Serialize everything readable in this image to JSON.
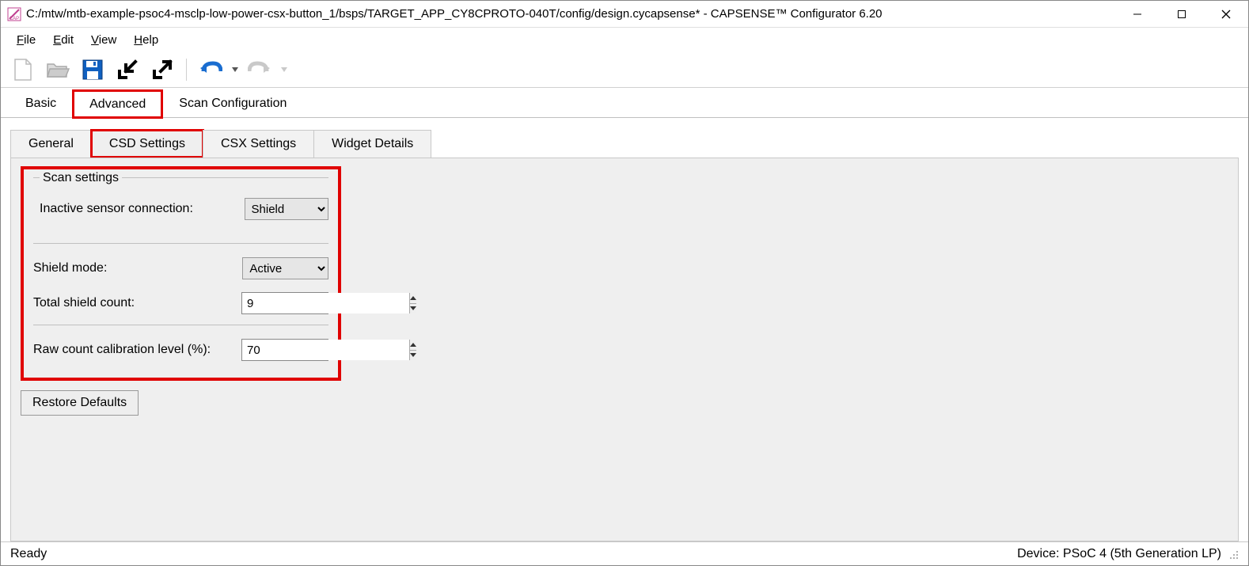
{
  "title": "C:/mtw/mtb-example-psoc4-msclp-low-power-csx-button_1/bsps/TARGET_APP_CY8CPROTO-040T/config/design.cycapsense* - CAPSENSE™ Configurator 6.20",
  "menu": {
    "file": "File",
    "edit": "Edit",
    "view": "View",
    "help": "Help"
  },
  "primaryTabs": {
    "basic": "Basic",
    "advanced": "Advanced",
    "scanConfig": "Scan Configuration"
  },
  "secondaryTabs": {
    "general": "General",
    "csd": "CSD Settings",
    "csx": "CSX Settings",
    "widget": "Widget Details"
  },
  "scanSettings": {
    "legend": "Scan settings",
    "inactiveLabel": "Inactive sensor connection:",
    "inactiveValue": "Shield"
  },
  "shield": {
    "modeLabel": "Shield mode:",
    "modeValue": "Active",
    "countLabel": "Total shield count:",
    "countValue": "9"
  },
  "rawCount": {
    "label": "Raw count calibration level (%):",
    "value": "70"
  },
  "restoreDefaults": "Restore Defaults",
  "status": {
    "left": "Ready",
    "right": "Device: PSoC 4 (5th Generation LP)"
  }
}
